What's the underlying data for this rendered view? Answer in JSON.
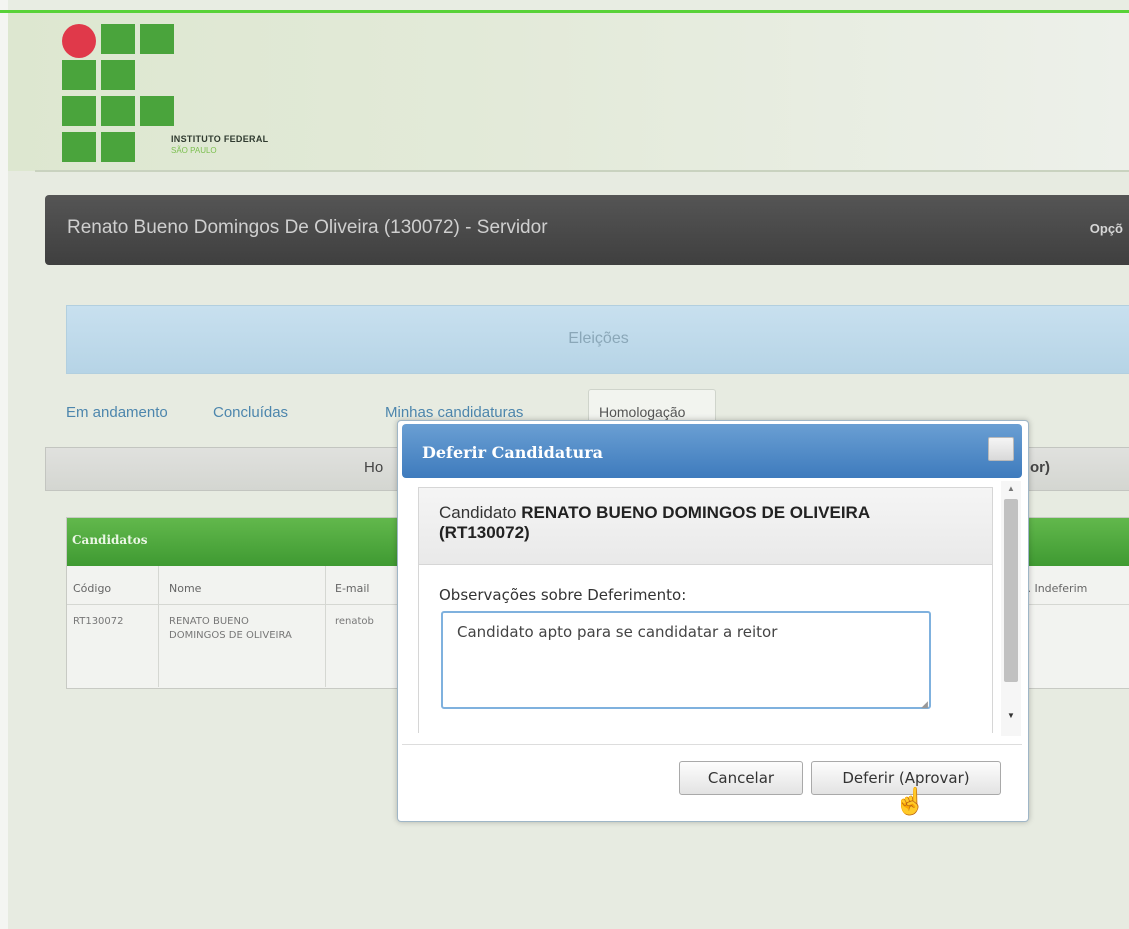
{
  "logo": {
    "line1": "INSTITUTO FEDERAL",
    "line2": "SÃO PAULO",
    "brand_green": "#4aa43c",
    "brand_red": "#e0394a"
  },
  "userbar": {
    "user": "Renato Bueno Domingos De Oliveira (130072) - Servidor",
    "options": "Opçõ"
  },
  "section": {
    "title": "Eleições"
  },
  "tabs": [
    {
      "label": "Em andamento"
    },
    {
      "label": "Concluídas"
    },
    {
      "label": "Minhas candidaturas"
    },
    {
      "label": "Homologação",
      "active": true
    }
  ],
  "panel": {
    "title_left": "Ho",
    "title_right": "or)"
  },
  "candidates": {
    "title": "Candidatos",
    "columns": [
      "Código",
      "Nome",
      "E-mail",
      "os. Indeferim"
    ],
    "row": {
      "code": "RT130072",
      "name": "RENATO BUENO DOMINGOS DE OLIVEIRA",
      "email": "renatob"
    }
  },
  "modal": {
    "title": "Deferir Candidatura",
    "candidate_prefix": "Candidato",
    "candidate_name": "RENATO BUENO DOMINGOS DE OLIVEIRA (RT130072)",
    "obs_label": "Observações sobre Deferimento:",
    "obs_value": "Candidato apto para se candidatar a reitor",
    "cancel_label": "Cancelar",
    "approve_label": "Deferir (Aprovar)"
  },
  "colors": {
    "accent_blue": "#3e7bbd",
    "header_green": "#4aa43c",
    "dark_bar": "#4a4a4a"
  }
}
